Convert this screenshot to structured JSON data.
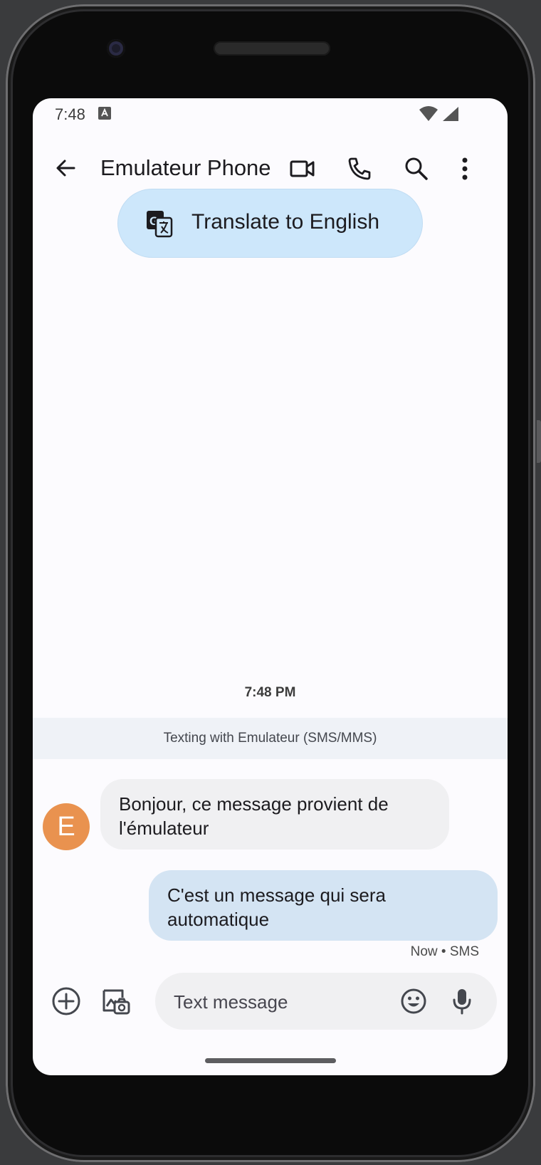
{
  "status_bar": {
    "time": "7:48"
  },
  "top_bar": {
    "title": "Emulateur Phone"
  },
  "translate_chip": {
    "label": "Translate to English"
  },
  "conversation": {
    "timestamp": "7:48 PM",
    "banner": "Texting with Emulateur (SMS/MMS)",
    "avatar_letter": "E",
    "avatar_color": "#e9924f",
    "incoming_message": "Bonjour, ce message provient de l'émulateur",
    "outgoing_message": "C'est un message qui sera automatique",
    "outgoing_meta": "Now • SMS"
  },
  "compose": {
    "placeholder": "Text message"
  },
  "icons": {
    "back": "arrow-back-icon",
    "video": "video-call-icon",
    "phone": "phone-call-icon",
    "search": "search-icon",
    "more": "more-vert-icon",
    "translate": "translate-icon",
    "add": "add-circle-icon",
    "gallery": "gallery-icon",
    "emoji": "emoji-icon",
    "mic": "mic-icon"
  }
}
